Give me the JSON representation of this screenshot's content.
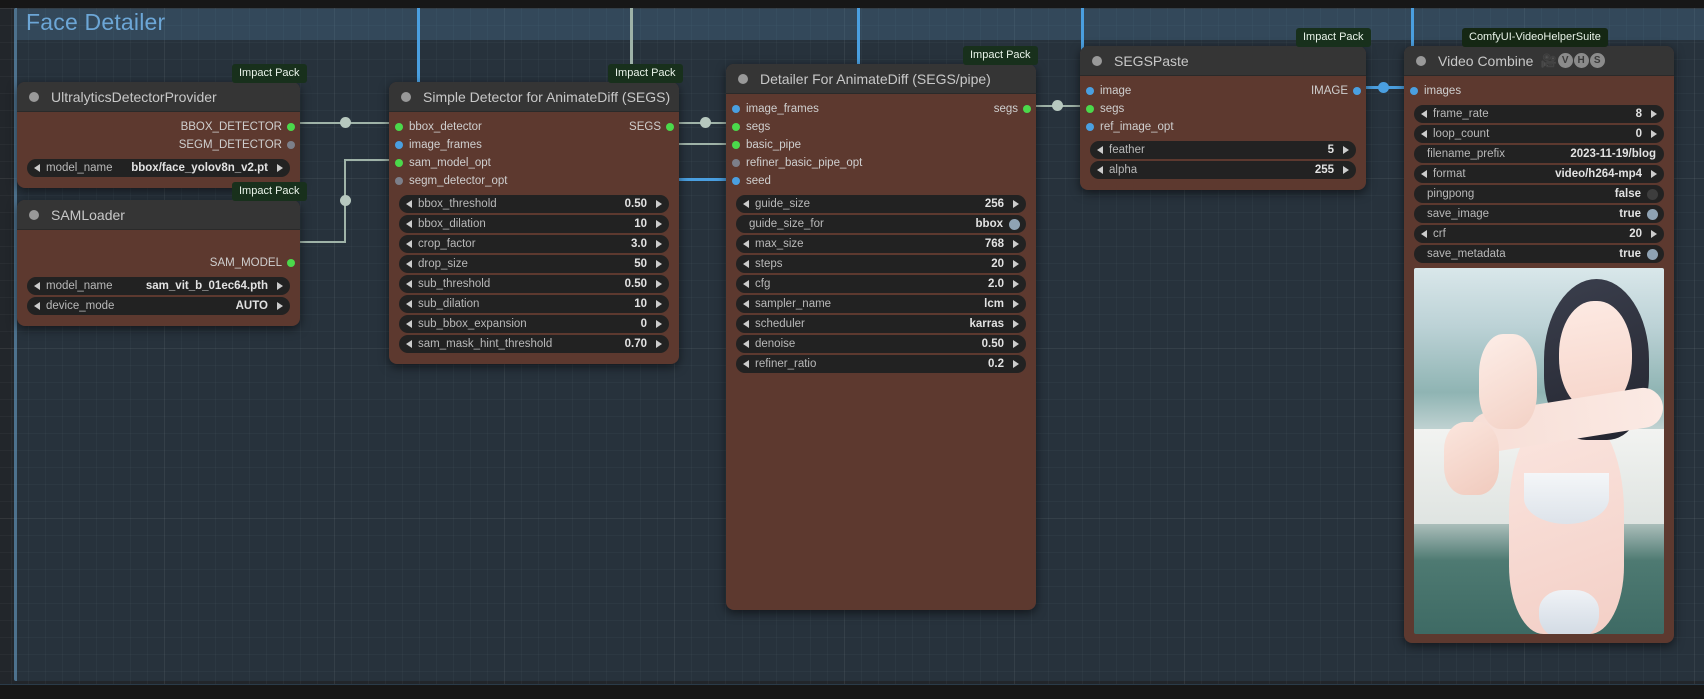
{
  "group": {
    "title": "Face Detailer"
  },
  "badges": {
    "impact_pack": "Impact Pack",
    "vhs": "ComfyUI-VideoHelperSuite"
  },
  "nodes": [
    {
      "id": "ultralytics",
      "title": "UltralyticsDetectorProvider",
      "pack": "Impact Pack",
      "inputs": [],
      "outputs": [
        {
          "label": "BBOX_DETECTOR",
          "color": "green"
        },
        {
          "label": "SEGM_DETECTOR",
          "color": "grey"
        }
      ],
      "widgets": [
        {
          "label": "model_name",
          "value": "bbox/face_yolov8n_v2.pt",
          "type": "combo"
        }
      ]
    },
    {
      "id": "samloader",
      "title": "SAMLoader",
      "pack": "Impact Pack",
      "inputs": [],
      "outputs": [
        {
          "label": "SAM_MODEL",
          "color": "green"
        }
      ],
      "widgets": [
        {
          "label": "model_name",
          "value": "sam_vit_b_01ec64.pth",
          "type": "combo"
        },
        {
          "label": "device_mode",
          "value": "AUTO",
          "type": "combo"
        }
      ]
    },
    {
      "id": "simple-detector",
      "title": "Simple Detector for AnimateDiff (SEGS)",
      "pack": "Impact Pack",
      "inputs": [
        {
          "label": "bbox_detector",
          "color": "green"
        },
        {
          "label": "image_frames",
          "color": "blue"
        },
        {
          "label": "sam_model_opt",
          "color": "green"
        },
        {
          "label": "segm_detector_opt",
          "color": "grey"
        }
      ],
      "outputs": [
        {
          "label": "SEGS",
          "color": "green"
        }
      ],
      "widgets": [
        {
          "label": "bbox_threshold",
          "value": "0.50",
          "type": "number"
        },
        {
          "label": "bbox_dilation",
          "value": "10",
          "type": "number"
        },
        {
          "label": "crop_factor",
          "value": "3.0",
          "type": "number"
        },
        {
          "label": "drop_size",
          "value": "50",
          "type": "number"
        },
        {
          "label": "sub_threshold",
          "value": "0.50",
          "type": "number"
        },
        {
          "label": "sub_dilation",
          "value": "10",
          "type": "number"
        },
        {
          "label": "sub_bbox_expansion",
          "value": "0",
          "type": "number"
        },
        {
          "label": "sam_mask_hint_threshold",
          "value": "0.70",
          "type": "number"
        }
      ]
    },
    {
      "id": "detailer",
      "title": "Detailer For AnimateDiff (SEGS/pipe)",
      "pack": "Impact Pack",
      "inputs": [
        {
          "label": "image_frames",
          "color": "blue"
        },
        {
          "label": "segs",
          "color": "green"
        },
        {
          "label": "basic_pipe",
          "color": "green"
        },
        {
          "label": "refiner_basic_pipe_opt",
          "color": "grey"
        },
        {
          "label": "seed",
          "color": "blue"
        }
      ],
      "outputs": [],
      "widgets": [
        {
          "label": "guide_size",
          "value": "256",
          "type": "number"
        },
        {
          "label": "guide_size_for",
          "value": "bbox",
          "type": "toggle-on"
        },
        {
          "label": "max_size",
          "value": "768",
          "type": "number"
        },
        {
          "label": "steps",
          "value": "20",
          "type": "number"
        },
        {
          "label": "cfg",
          "value": "2.0",
          "type": "number"
        },
        {
          "label": "sampler_name",
          "value": "lcm",
          "type": "combo"
        },
        {
          "label": "scheduler",
          "value": "karras",
          "type": "combo"
        },
        {
          "label": "denoise",
          "value": "0.50",
          "type": "number"
        },
        {
          "label": "refiner_ratio",
          "value": "0.2",
          "type": "number"
        }
      ]
    },
    {
      "id": "segspaste",
      "title": "SEGSPaste",
      "pack": "Impact Pack",
      "inputs": [
        {
          "label": "image",
          "color": "blue"
        },
        {
          "label": "segs",
          "color": "green"
        },
        {
          "label": "ref_image_opt",
          "color": "blue"
        }
      ],
      "outputs": [
        {
          "label": "IMAGE",
          "color": "blue"
        }
      ],
      "widgets": [
        {
          "label": "feather",
          "value": "5",
          "type": "number"
        },
        {
          "label": "alpha",
          "value": "255",
          "type": "number"
        }
      ]
    },
    {
      "id": "video-combine",
      "title": "Video Combine",
      "title_badges": [
        "VHS-camera",
        "V",
        "H",
        "S"
      ],
      "pack": "ComfyUI-VideoHelperSuite",
      "inputs": [
        {
          "label": "images",
          "color": "blue"
        }
      ],
      "outputs": [],
      "widgets": [
        {
          "label": "frame_rate",
          "value": "8",
          "type": "number"
        },
        {
          "label": "loop_count",
          "value": "0",
          "type": "number"
        },
        {
          "label": "filename_prefix",
          "value": "2023-11-19/blog",
          "type": "text"
        },
        {
          "label": "format",
          "value": "video/h264-mp4",
          "type": "combo"
        },
        {
          "label": "pingpong",
          "value": "false",
          "type": "toggle-off"
        },
        {
          "label": "save_image",
          "value": "true",
          "type": "toggle-on"
        },
        {
          "label": "crf",
          "value": "20",
          "type": "number"
        },
        {
          "label": "save_metadata",
          "value": "true",
          "type": "toggle-on"
        }
      ],
      "has_preview": true
    }
  ],
  "colors": {
    "node_body": "#5d392f",
    "node_header": "#353535",
    "widget_bg": "#222222",
    "link_default": "#9fb3a8",
    "link_image": "#4a9fe0",
    "slot_green": "#4bd94b",
    "slot_blue": "#4a9fe0",
    "slot_grey": "#7c7f8a",
    "group_accent": "#6ca6d6",
    "canvas_bg": "#22262b"
  }
}
